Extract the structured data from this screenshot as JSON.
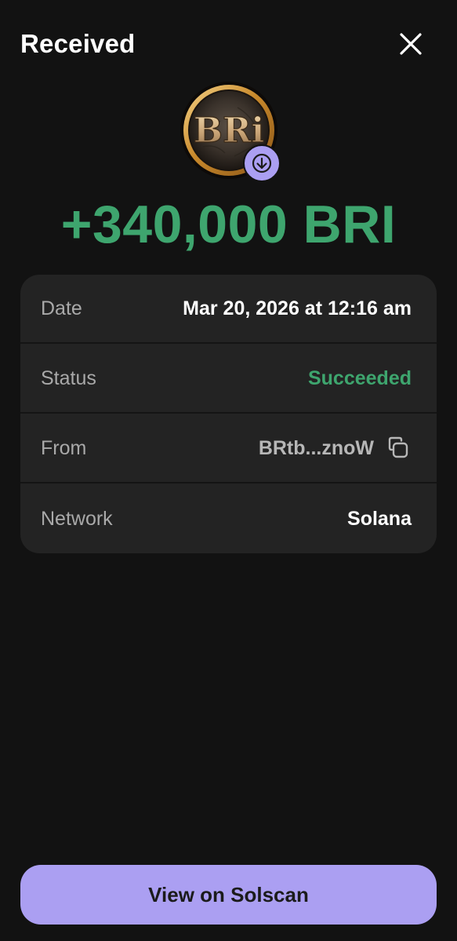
{
  "header": {
    "title": "Received",
    "close_icon": "close-icon"
  },
  "token": {
    "logo_text": "BRi",
    "badge_icon": "arrow-down-icon",
    "amount": "+340,000 BRI"
  },
  "details": [
    {
      "label": "Date",
      "value": "Mar 20, 2026 at 12:16 am"
    },
    {
      "label": "Status",
      "value": "Succeeded"
    },
    {
      "label": "From",
      "value": "BRtb...znoW",
      "icon": "copy-icon"
    },
    {
      "label": "Network",
      "value": "Solana"
    }
  ],
  "footer": {
    "button_label": "View on Solscan"
  },
  "colors": {
    "background": "#121212",
    "card": "#232323",
    "success": "#3ea56e",
    "accent": "#ab9ff2"
  }
}
